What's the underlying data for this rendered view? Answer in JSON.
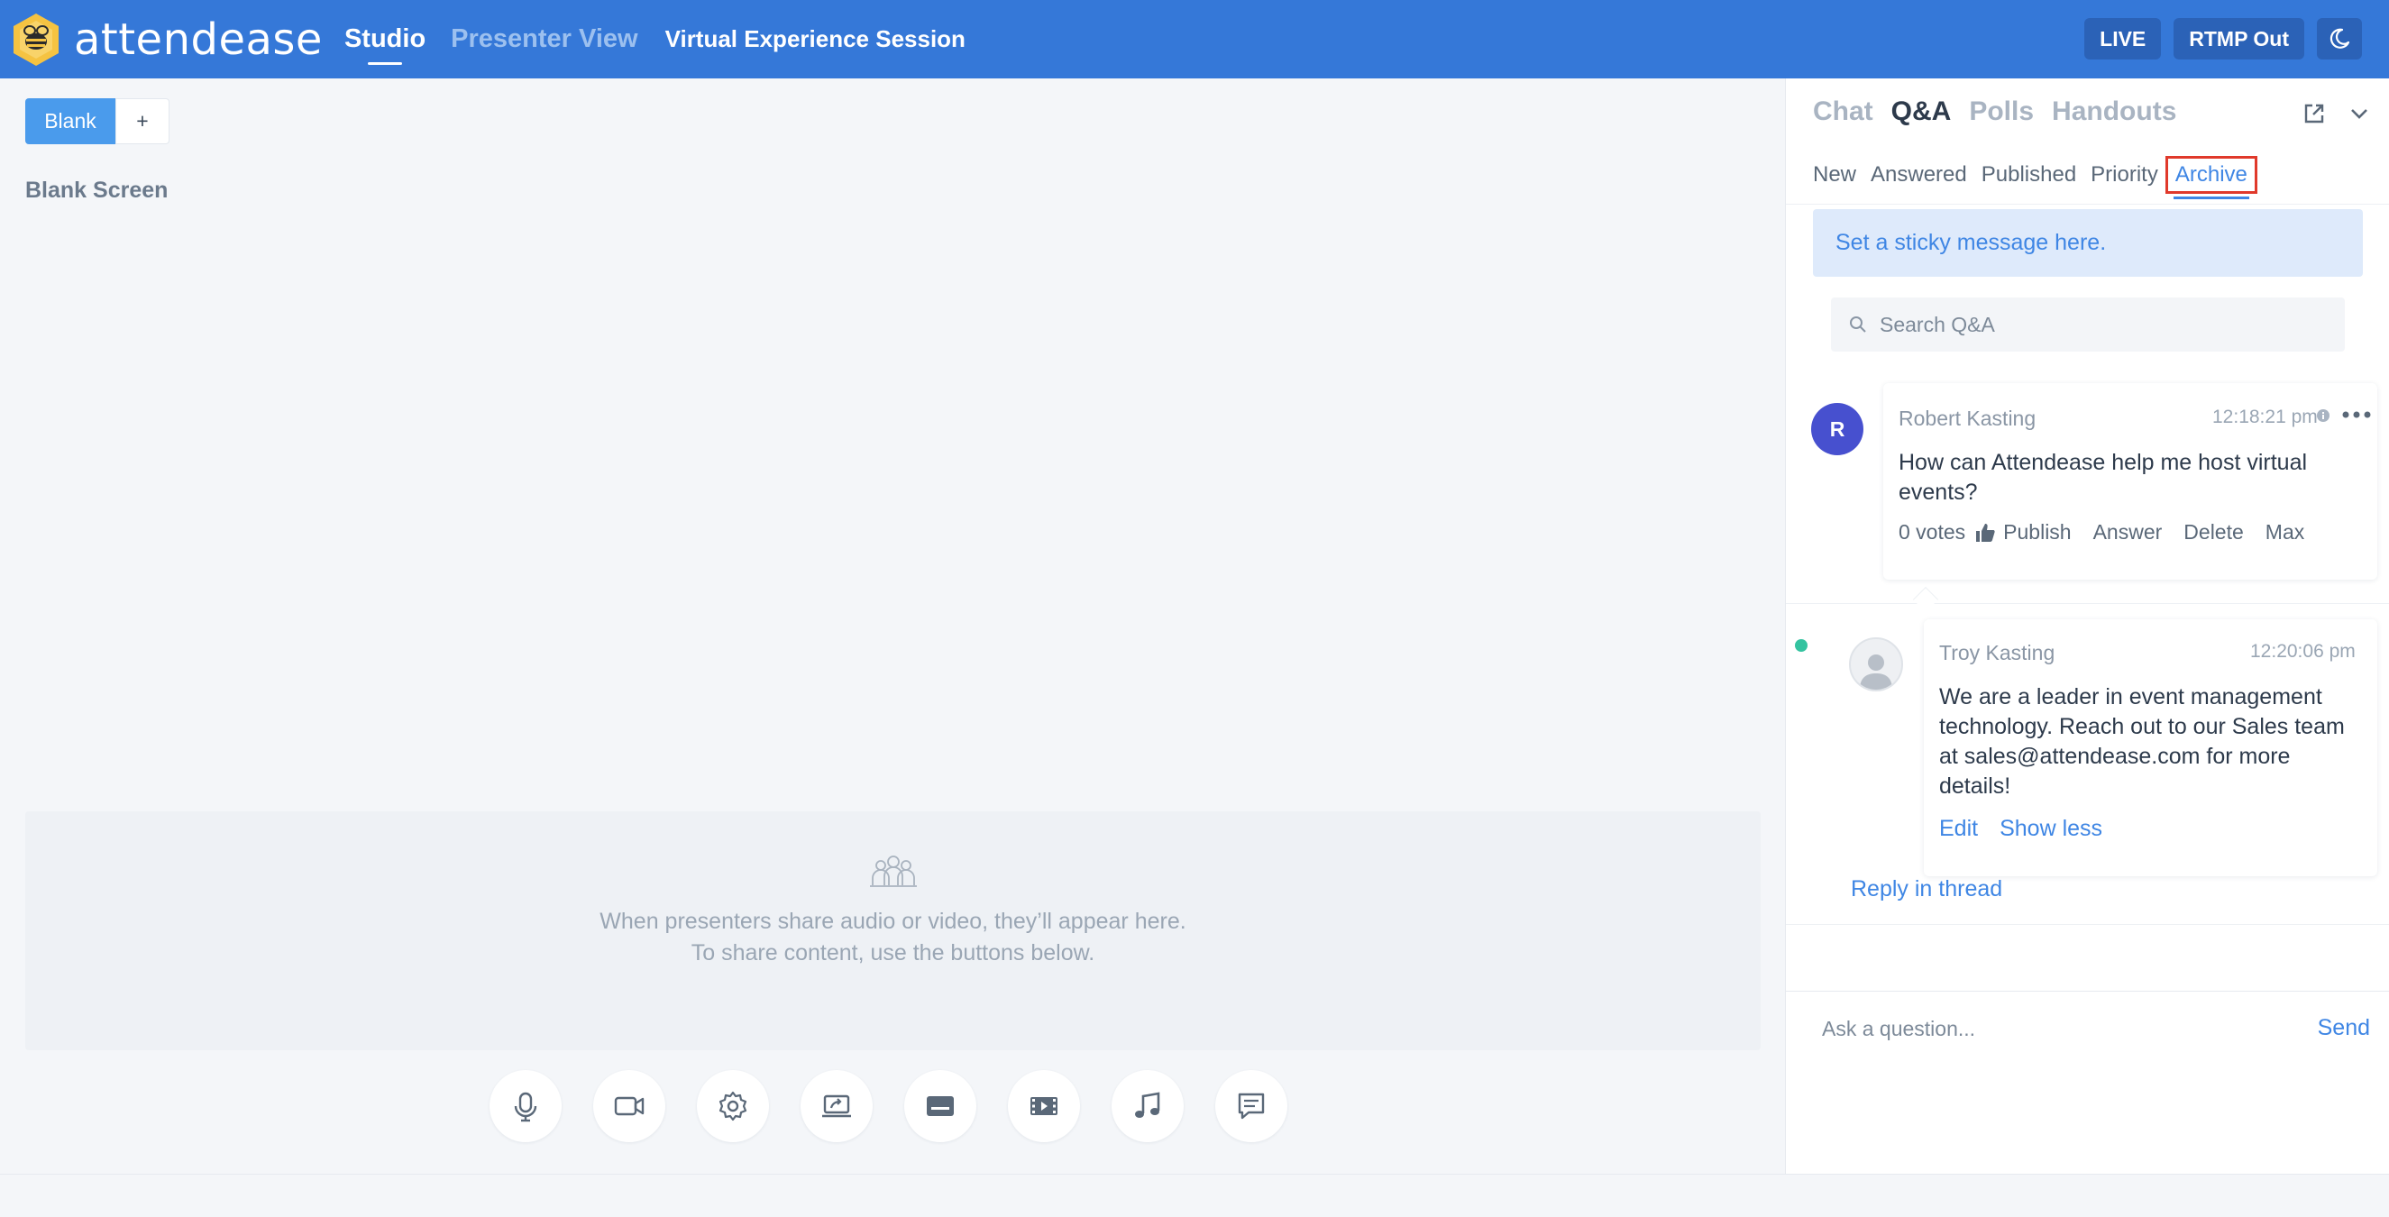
{
  "app": {
    "logo_text": "attendease",
    "nav_tabs": [
      {
        "label": "Studio",
        "active": true
      },
      {
        "label": "Presenter View",
        "active": false
      }
    ],
    "session_title": "Virtual Experience Session",
    "live_label": "LIVE",
    "rtmp_label": "RTMP Out",
    "theme_icon": "moon-icon"
  },
  "colors": {
    "topbar": "#3578d8",
    "accent": "#3f86e4",
    "highlight_border": "#e0392b",
    "online": "#34c3a0",
    "avatar_r": "#4750cf"
  },
  "scenes": {
    "tabs": [
      {
        "label": "Blank",
        "active": true
      }
    ],
    "add_label": "+",
    "current_title": "Blank Screen"
  },
  "presenters": {
    "message_line1": "When presenters share audio or video, they’ll appear here.",
    "message_line2": "To share content, use the buttons below."
  },
  "toolbar": [
    "microphone-icon",
    "camera-icon",
    "settings-icon",
    "share-screen-icon",
    "lower-third-icon",
    "video-clip-icon",
    "music-icon",
    "comment-icon"
  ],
  "panel": {
    "tabs": [
      {
        "label": "Chat",
        "active": false
      },
      {
        "label": "Q&A",
        "active": true
      },
      {
        "label": "Polls",
        "active": false
      },
      {
        "label": "Handouts",
        "active": false
      }
    ],
    "subtabs": [
      {
        "label": "New",
        "active": false
      },
      {
        "label": "Answered",
        "active": false
      },
      {
        "label": "Published",
        "active": false
      },
      {
        "label": "Priority",
        "active": false
      },
      {
        "label": "Archive",
        "active": true
      }
    ],
    "sticky_message": "Set a sticky message here.",
    "search_placeholder": "Search Q&A",
    "question": {
      "avatar_initial": "R",
      "author": "Robert Kasting",
      "time": "12:18:21 pm",
      "text_line1": "How can Attendease help me host virtual",
      "text_line2": "events?",
      "votes": "0 votes",
      "actions": [
        "Publish",
        "Answer",
        "Delete",
        "Max"
      ]
    },
    "answer": {
      "author": "Troy Kasting",
      "time": "12:20:06 pm",
      "text_lines": [
        "We are a leader in event management",
        "technology. Reach out to our Sales team",
        "at sales@attendease.com for more",
        "details!"
      ],
      "edit_label": "Edit",
      "show_less_label": "Show less"
    },
    "reply_label": "Reply in thread",
    "composer_placeholder": "Ask a question...",
    "send_label": "Send"
  }
}
